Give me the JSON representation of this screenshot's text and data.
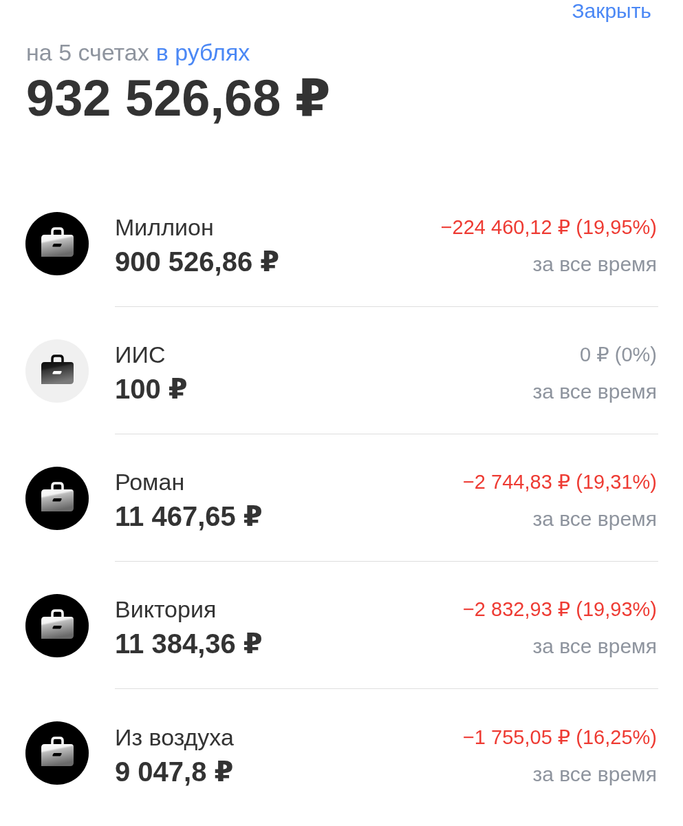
{
  "header": {
    "close_button": "Закрыть"
  },
  "summary": {
    "label": "на 5 счетах",
    "currency_link": "в рублях",
    "total": "932 526,68 ₽"
  },
  "accounts": [
    {
      "kind": "dark",
      "name": "Миллион",
      "balance": "900 526,86 ₽",
      "change": "−224 460,12 ₽ (19,95%)",
      "negative": true,
      "period": "за все время"
    },
    {
      "kind": "light",
      "name": "ИИС",
      "balance": "100 ₽",
      "change": "0 ₽ (0%)",
      "negative": false,
      "period": "за все время"
    },
    {
      "kind": "dark",
      "name": "Роман",
      "balance": "11 467,65 ₽",
      "change": "−2 744,83 ₽ (19,31%)",
      "negative": true,
      "period": "за все время"
    },
    {
      "kind": "dark",
      "name": "Виктория",
      "balance": "11 384,36 ₽",
      "change": "−2 832,93 ₽ (19,93%)",
      "negative": true,
      "period": "за все время"
    },
    {
      "kind": "dark",
      "name": "Из воздуха",
      "balance": "9 047,8 ₽",
      "change": "−1 755,05 ₽ (16,25%)",
      "negative": true,
      "period": "за все время"
    }
  ]
}
